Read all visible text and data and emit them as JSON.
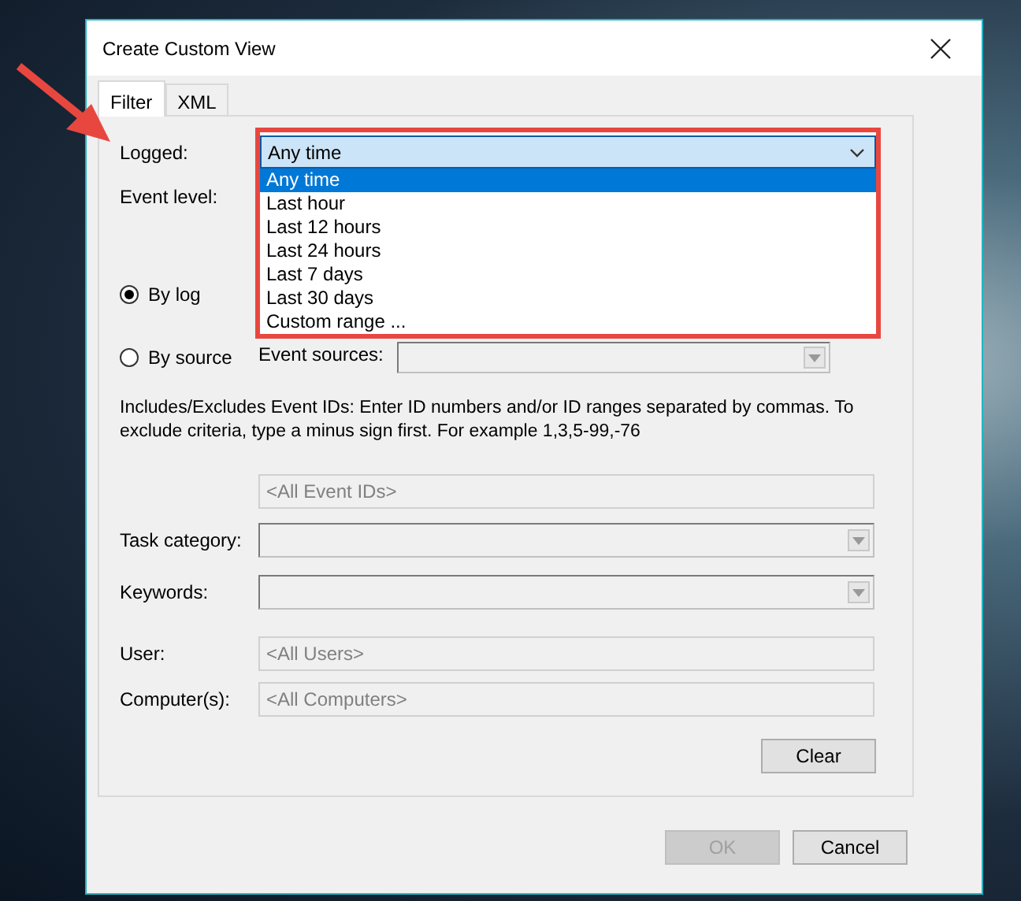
{
  "window": {
    "title": "Create Custom View"
  },
  "tabs": [
    {
      "label": "Filter",
      "selected": true
    },
    {
      "label": "XML",
      "selected": false
    }
  ],
  "logged": {
    "label": "Logged:",
    "value": "Any time",
    "expanded": true,
    "options": [
      {
        "label": "Any time",
        "selected": true
      },
      {
        "label": "Last hour",
        "selected": false
      },
      {
        "label": "Last 12 hours",
        "selected": false
      },
      {
        "label": "Last 24 hours",
        "selected": false
      },
      {
        "label": "Last 7 days",
        "selected": false
      },
      {
        "label": "Last 30 days",
        "selected": false
      },
      {
        "label": "Custom range ...",
        "selected": false
      }
    ]
  },
  "event_level": {
    "label": "Event level:"
  },
  "source_mode": [
    {
      "label": "By log",
      "selected": true
    },
    {
      "label": "By source",
      "selected": false
    }
  ],
  "event_sources": {
    "label": "Event sources:"
  },
  "description": "Includes/Excludes Event IDs: Enter ID numbers and/or ID ranges separated by commas. To exclude criteria, type a minus sign first. For example 1,3,5-99,-76",
  "event_ids": {
    "placeholder": "<All Event IDs>"
  },
  "task_category": {
    "label": "Task category:"
  },
  "keywords": {
    "label": "Keywords:"
  },
  "user": {
    "label": "User:",
    "placeholder": "<All Users>"
  },
  "computers": {
    "label": "Computer(s):",
    "placeholder": "<All Computers>"
  },
  "buttons": {
    "clear": {
      "label": "Clear",
      "disabled": false
    },
    "ok": {
      "label": "OK",
      "disabled": true
    },
    "cancel": {
      "label": "Cancel",
      "disabled": false
    }
  }
}
